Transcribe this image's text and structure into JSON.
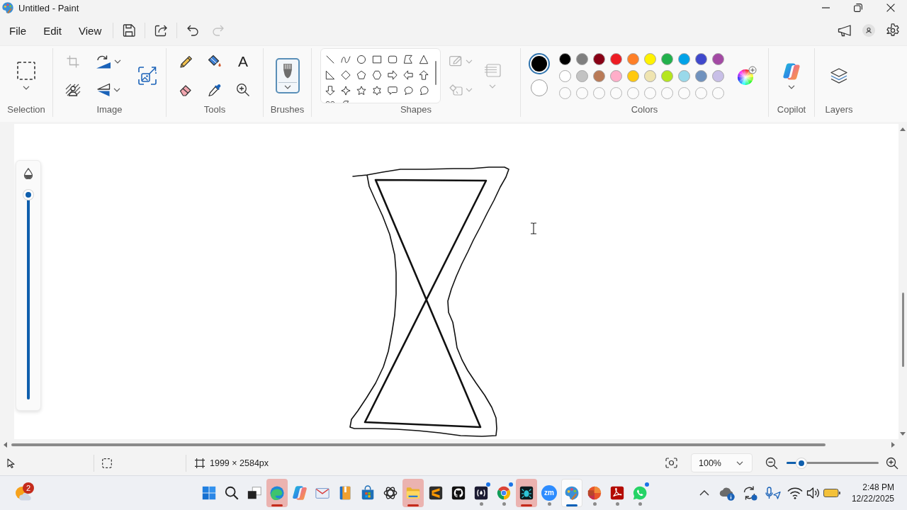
{
  "window": {
    "title": "Untitled - Paint"
  },
  "menu": [
    "File",
    "Edit",
    "View"
  ],
  "quick_actions": {
    "undo": {
      "disabled": false
    },
    "redo": {
      "disabled": true
    }
  },
  "ribbon": {
    "selection": {
      "label": "Selection"
    },
    "image": {
      "label": "Image",
      "crop": {
        "disabled": true
      }
    },
    "tools": {
      "label": "Tools",
      "items": [
        {
          "kind": "pencil",
          "selected": false
        },
        {
          "kind": "fill",
          "selected": false
        },
        {
          "kind": "text",
          "glyph": "A",
          "selected": false
        },
        {
          "kind": "eraser",
          "selected": false
        },
        {
          "kind": "picker",
          "selected": false
        },
        {
          "kind": "magnifier",
          "selected": false
        }
      ]
    },
    "brushes": {
      "label": "Brushes",
      "selected": true
    },
    "shapes": {
      "label": "Shapes",
      "outline": {
        "disabled": true
      },
      "fill": {
        "disabled": true
      },
      "size": {
        "disabled": true
      }
    },
    "colors": {
      "label": "Colors",
      "current": [
        {
          "color": "#000000",
          "selected": true
        },
        {
          "color": "#ffffff",
          "selected": false
        }
      ],
      "palette": [
        {
          "color": "#000000"
        },
        {
          "color": "#7f7f7f"
        },
        {
          "color": "#880015"
        },
        {
          "color": "#ed1c24"
        },
        {
          "color": "#ff7f27"
        },
        {
          "color": "#fff200"
        },
        {
          "color": "#22b14c"
        },
        {
          "color": "#00a2e8"
        },
        {
          "color": "#3f48cc"
        },
        {
          "color": "#a349a4"
        },
        {
          "color": "#ffffff"
        },
        {
          "color": "#c3c3c3"
        },
        {
          "color": "#b97a57"
        },
        {
          "color": "#ffaec9"
        },
        {
          "color": "#ffc90e"
        },
        {
          "color": "#efe4b0"
        },
        {
          "color": "#b5e61d"
        },
        {
          "color": "#99d9ea"
        },
        {
          "color": "#7092be"
        },
        {
          "color": "#c8bfe7"
        }
      ]
    },
    "copilot": {
      "label": "Copilot"
    },
    "layers": {
      "label": "Layers"
    }
  },
  "canvas": {
    "brush_size": {
      "level": 1
    }
  },
  "status_bar": {
    "canvas_size": "1999 × 2584px",
    "zoom": "100%",
    "zoom_slider": {
      "level": 0.16
    }
  },
  "taskbar": {
    "weather": {
      "badge": "2"
    },
    "apps": [
      {
        "kind": "start",
        "running": false,
        "selected": false,
        "flashing": false,
        "notification_dot": false
      },
      {
        "kind": "search",
        "running": false,
        "selected": false,
        "flashing": false,
        "notification_dot": false
      },
      {
        "kind": "task-view",
        "running": false,
        "selected": false,
        "flashing": false,
        "notification_dot": false
      },
      {
        "kind": "swirl",
        "running": true,
        "selected": false,
        "flashing": true,
        "notification_dot": false
      },
      {
        "kind": "loop",
        "running": false,
        "selected": false,
        "flashing": false,
        "notification_dot": false
      },
      {
        "kind": "mail",
        "running": false,
        "selected": false,
        "flashing": false,
        "notification_dot": false
      },
      {
        "kind": "notebook",
        "running": false,
        "selected": false,
        "flashing": false,
        "notification_dot": false
      },
      {
        "kind": "store",
        "running": false,
        "selected": false,
        "flashing": false,
        "notification_dot": false
      },
      {
        "kind": "knot",
        "running": false,
        "selected": false,
        "flashing": false,
        "notification_dot": false
      },
      {
        "kind": "folder",
        "running": true,
        "selected": false,
        "flashing": true,
        "notification_dot": false
      },
      {
        "kind": "stripes",
        "running": false,
        "selected": false,
        "flashing": false,
        "notification_dot": false
      },
      {
        "kind": "cat",
        "running": false,
        "selected": false,
        "flashing": false,
        "notification_dot": false
      },
      {
        "kind": "flame",
        "running": true,
        "selected": false,
        "flashing": false,
        "notification_dot": true
      },
      {
        "kind": "tricolor",
        "running": true,
        "selected": false,
        "flashing": false,
        "notification_dot": true
      },
      {
        "kind": "bug",
        "running": true,
        "selected": false,
        "flashing": true,
        "notification_dot": false
      },
      {
        "kind": "round-logo",
        "label": "zm",
        "running": true,
        "selected": false,
        "flashing": false,
        "notification_dot": false
      },
      {
        "kind": "palette",
        "running": true,
        "selected": true,
        "flashing": false,
        "notification_dot": false
      },
      {
        "kind": "segments",
        "running": true,
        "selected": false,
        "flashing": false,
        "notification_dot": false
      },
      {
        "kind": "curl",
        "running": true,
        "selected": false,
        "flashing": false,
        "notification_dot": false
      },
      {
        "kind": "chat",
        "running": true,
        "selected": false,
        "flashing": false,
        "notification_dot": true
      }
    ],
    "clock": {
      "time": "2:48 PM",
      "date": "12/22/2025"
    }
  }
}
